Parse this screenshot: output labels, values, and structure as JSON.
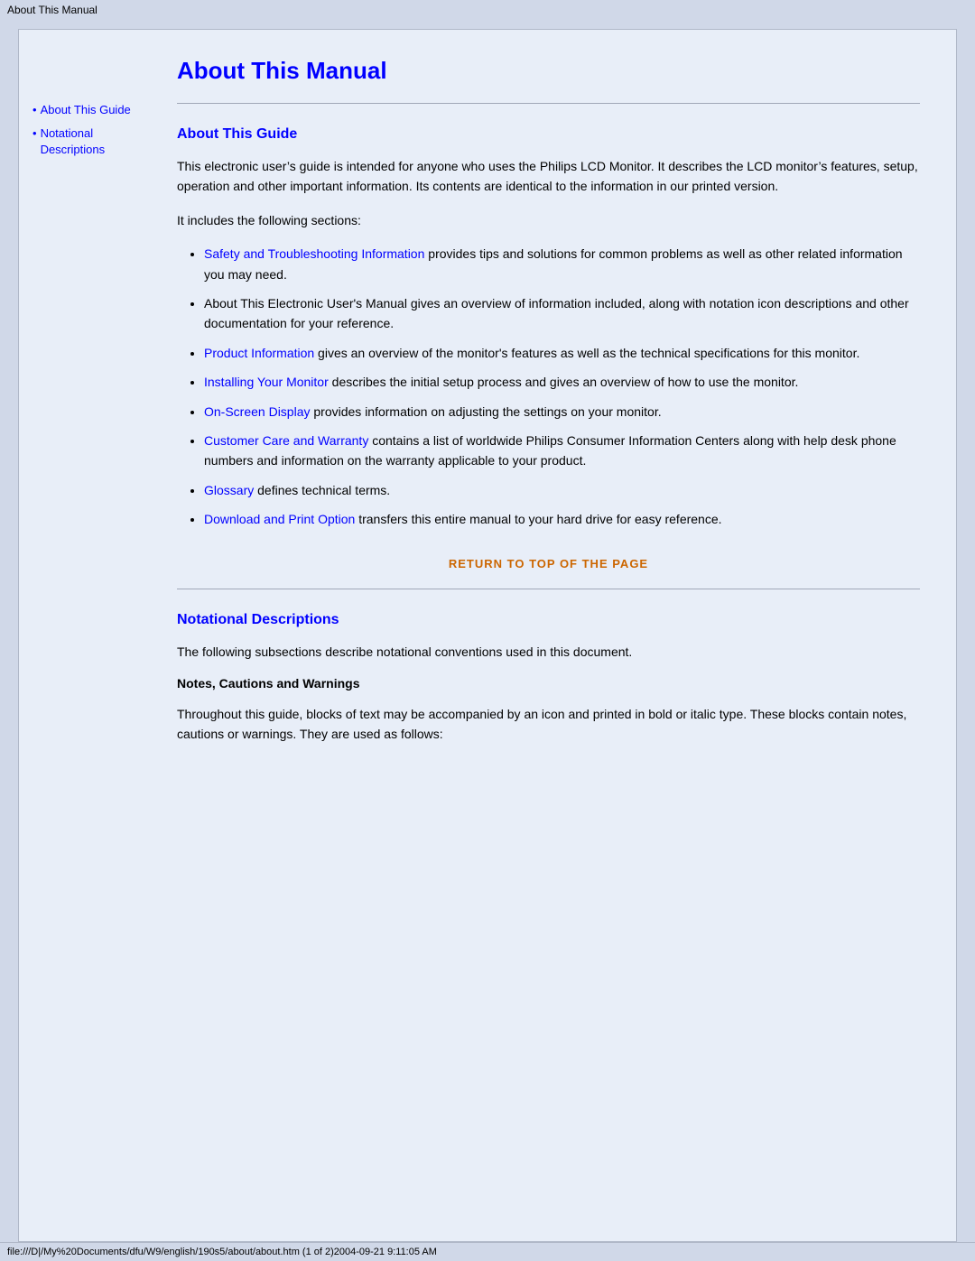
{
  "titleBar": {
    "text": "About This Manual"
  },
  "sidebar": {
    "items": [
      {
        "label": "About This Guide",
        "href": "#about-this-guide"
      },
      {
        "label": "Notational Descriptions",
        "href": "#notational-descriptions"
      }
    ]
  },
  "main": {
    "pageTitle": "About This Manual",
    "sections": [
      {
        "id": "about-this-guide",
        "title": "About This Guide",
        "intro1": "This electronic user’s guide is intended for anyone who uses the Philips LCD Monitor. It describes the LCD monitor’s features, setup, operation and other important information. Its contents are identical to the information in our printed version.",
        "intro2": "It includes the following sections:",
        "bulletItems": [
          {
            "linkText": "Safety and Troubleshooting Information",
            "isLink": true,
            "rest": " provides tips and solutions for common problems as well as other related information you may need."
          },
          {
            "linkText": "",
            "isLink": false,
            "rest": "About This Electronic User’s Manual gives an overview of information included, along with notation icon descriptions and other documentation for your reference."
          },
          {
            "linkText": "Product Information",
            "isLink": true,
            "rest": " gives an overview of the monitor’s features as well as the technical specifications for this monitor."
          },
          {
            "linkText": "Installing Your Monitor",
            "isLink": true,
            "rest": " describes the initial setup process and gives an overview of how to use the monitor."
          },
          {
            "linkText": "On-Screen Display",
            "isLink": true,
            "rest": " provides information on adjusting the settings on your monitor."
          },
          {
            "linkText": "Customer Care and Warranty",
            "isLink": true,
            "rest": " contains a list of worldwide Philips Consumer Information Centers along with help desk phone numbers and information on the warranty applicable to your product."
          },
          {
            "linkText": "Glossary",
            "isLink": true,
            "rest": " defines technical terms."
          },
          {
            "linkText": "Download and Print Option",
            "isLink": true,
            "rest": " transfers this entire manual to your hard drive for easy reference."
          }
        ],
        "returnLink": "RETURN TO TOP OF THE PAGE"
      },
      {
        "id": "notational-descriptions",
        "title": "Notational Descriptions",
        "intro": "The following subsections describe notational conventions used in this document.",
        "subsectionTitle": "Notes, Cautions and Warnings",
        "subsectionText": "Throughout this guide, blocks of text may be accompanied by an icon and printed in bold or italic type. These blocks contain notes, cautions or warnings. They are used as follows:"
      }
    ]
  },
  "statusBar": {
    "text": "file:///D|/My%20Documents/dfu/W9/english/190s5/about/about.htm (1 of 2)2004-09-21 9:11:05 AM"
  }
}
